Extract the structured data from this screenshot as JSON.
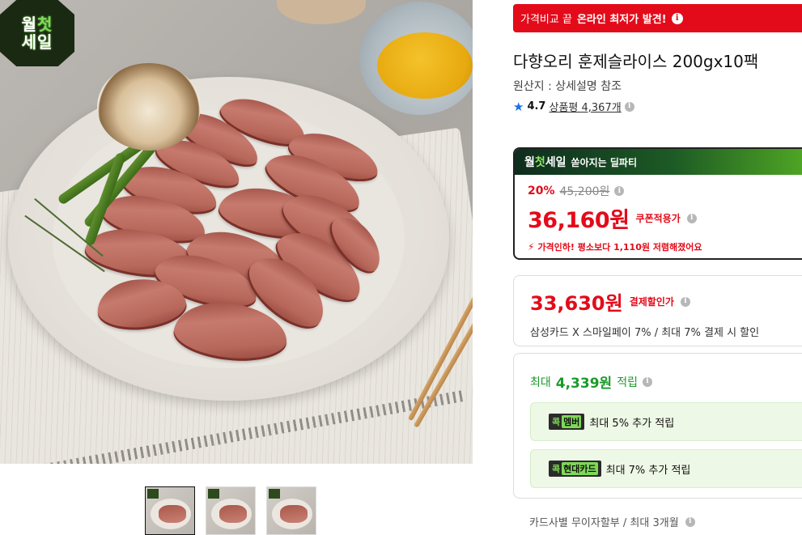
{
  "hero": {
    "badge_line1_a": "월",
    "badge_line1_b": "첫",
    "badge_line2": "세일"
  },
  "thumbnails": [
    {
      "label": "thumbnail-1",
      "active": true
    },
    {
      "label": "thumbnail-2",
      "active": false
    },
    {
      "label": "thumbnail-3",
      "active": false
    }
  ],
  "compare_banner": {
    "prefix": "가격비교 끝",
    "highlight": "온라인 최저가 발견!"
  },
  "product": {
    "title": "다향오리 훈제슬라이스 200gx10팩",
    "origin": "원산지 : 상세설명 참조",
    "rating": "4.7",
    "review_text": "상품평 4,367개"
  },
  "sale_box": {
    "head_logo_a": "월",
    "head_logo_b": "첫",
    "head_logo_c": "세일",
    "head_text": "쏟아지는 딜파티",
    "discount": "20%",
    "original_price": "45,200원",
    "sale_price": "36,160원",
    "sale_price_label": "쿠폰적용가",
    "notice": "가격인하! 평소보다 1,110원 저렴해졌어요"
  },
  "payment": {
    "price": "33,630원",
    "label": "결제할인가",
    "detail": "삼성카드 X 스마일페이 7% / 최대 7% 결제 시 할인"
  },
  "points": {
    "prefix": "최대",
    "value": "4,339원",
    "suffix": "적립",
    "items": [
      {
        "chip_a": "콕",
        "chip_b": "멤버",
        "text": "최대 5% 추가 적립"
      },
      {
        "chip_a": "콕",
        "chip_b": "현대카드",
        "text": "최대 7% 추가 적립"
      }
    ]
  },
  "installment": {
    "text": "카드사별 무이자할부 / 최대 3개월"
  },
  "icons": {
    "info": "i",
    "star": "★",
    "bolt": "⚡"
  },
  "colors": {
    "brand_red": "#e30b1a",
    "green": "#1b9a2b",
    "star_blue": "#1a6fe6"
  }
}
